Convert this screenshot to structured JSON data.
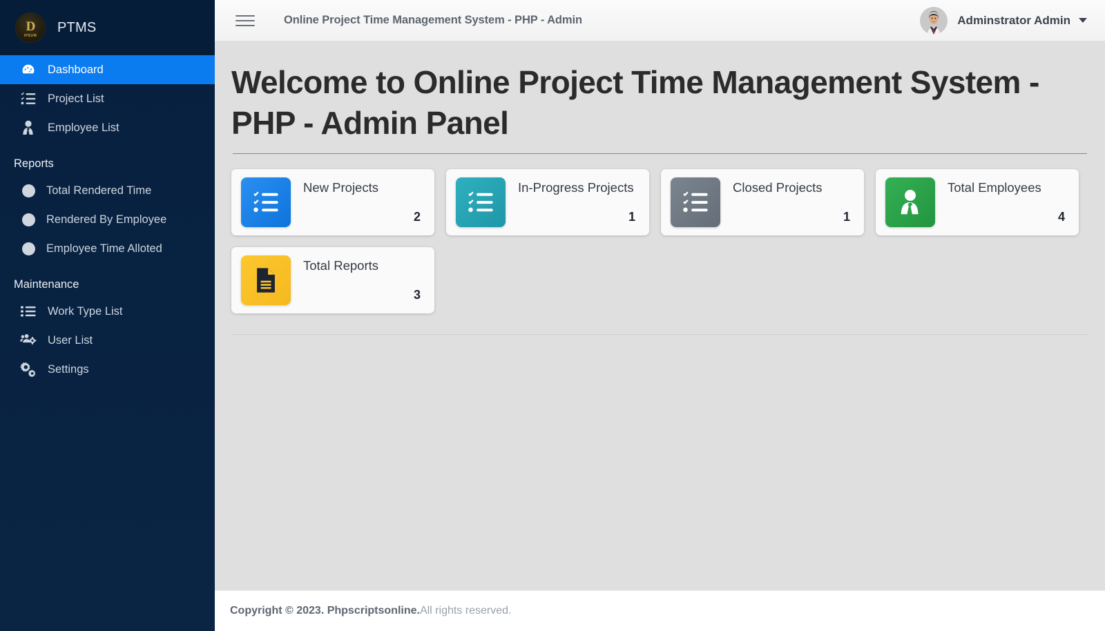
{
  "sidebar": {
    "brand": {
      "name": "PTMS",
      "logo_mono": "D",
      "logo_sub": "IPSUM"
    },
    "main_items": [
      {
        "label": "Dashboard",
        "icon": "dashboard-gauge-icon",
        "active": true
      },
      {
        "label": "Project List",
        "icon": "checklist-icon",
        "active": false
      },
      {
        "label": "Employee List",
        "icon": "user-tie-icon",
        "active": false
      }
    ],
    "reports_heading": "Reports",
    "reports_items": [
      {
        "label": "Total Rendered Time",
        "icon": "circle-bullet-icon"
      },
      {
        "label": "Rendered By Employee",
        "icon": "circle-bullet-icon"
      },
      {
        "label": "Employee Time Alloted",
        "icon": "circle-bullet-icon"
      }
    ],
    "maintenance_heading": "Maintenance",
    "maintenance_items": [
      {
        "label": "Work Type List",
        "icon": "list-ul-icon"
      },
      {
        "label": "User List",
        "icon": "users-cog-icon"
      },
      {
        "label": "Settings",
        "icon": "gears-icon"
      }
    ],
    "active_color": "#0b7bf0",
    "background_color": "#0b2545"
  },
  "topbar": {
    "menu_toggle_icon": "hamburger-icon",
    "title": "Online Project Time Management System - PHP - Admin",
    "user_name": "Adminstrator Admin",
    "avatar_icon": "user-avatar",
    "dropdown_icon": "caret-down-icon"
  },
  "main": {
    "page_title": "Welcome to Online Project Time Management System - PHP - Admin Panel",
    "divider_color": "#4f9ea8",
    "cards": [
      {
        "label": "New Projects",
        "value": "2",
        "color": "#1580e8",
        "icon": "checklist-icon"
      },
      {
        "label": "In-Progress Projects",
        "value": "1",
        "color": "#27a3b4",
        "icon": "checklist-icon"
      },
      {
        "label": "Closed Projects",
        "value": "1",
        "color": "#707a85",
        "icon": "checklist-icon"
      },
      {
        "label": "Total Employees",
        "value": "4",
        "color": "#2cа14a",
        "icon": "user-tie-icon"
      },
      {
        "label": "Total Reports",
        "value": "3",
        "color": "#fbc02d",
        "icon": "document-report-icon"
      }
    ]
  },
  "footer": {
    "copyright_bold": "Copyright © 2023. Phpscriptsonline.",
    "copyright_rest": " All rights reserved."
  }
}
